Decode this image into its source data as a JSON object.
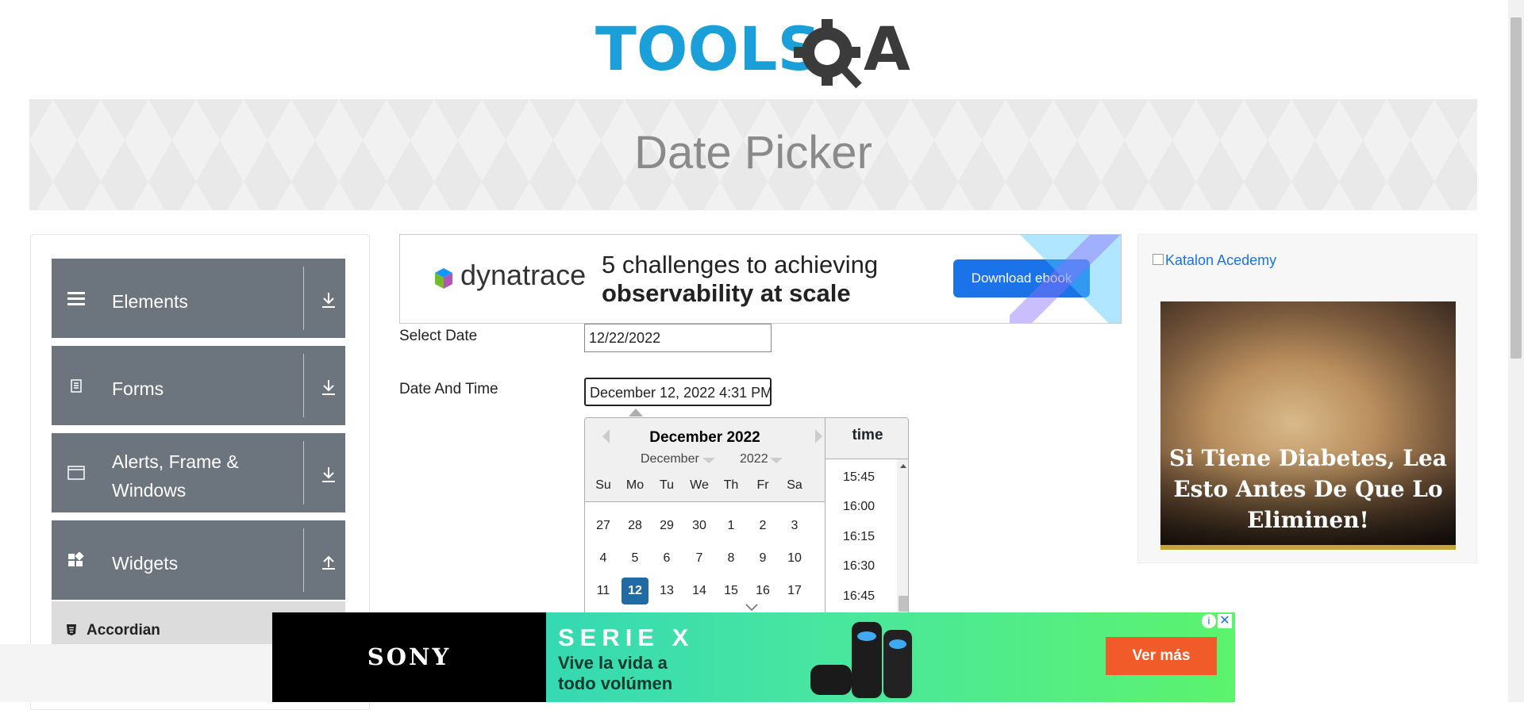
{
  "header": {
    "logo_text": "TOOLSQA",
    "page_title": "Date Picker"
  },
  "sidebar": {
    "groups": [
      {
        "label": "Elements",
        "icon": "hamburger-icon",
        "arrow": "download-icon"
      },
      {
        "label": "Forms",
        "icon": "document-icon",
        "arrow": "download-icon"
      },
      {
        "label": "Alerts, Frame &",
        "label2": "Windows",
        "icon": "window-icon",
        "arrow": "download-icon"
      },
      {
        "label": "Widgets",
        "icon": "widgets-icon",
        "arrow": "upload-icon"
      }
    ],
    "active_item": "Accordian"
  },
  "ad_top": {
    "brand": "dynatrace",
    "line1": "5 challenges to achieving",
    "line2": "observability at scale",
    "button": "Download ebook"
  },
  "form": {
    "select_date_label": "Select Date",
    "select_date_value": "12/22/2022",
    "date_time_label": "Date And Time",
    "date_time_value": "December 12, 2022 4:31 PM"
  },
  "picker": {
    "title": "December 2022",
    "month_select": "December",
    "year_select": "2022",
    "day_names": [
      "Su",
      "Mo",
      "Tu",
      "We",
      "Th",
      "Fr",
      "Sa"
    ],
    "weeks": [
      [
        "27",
        "28",
        "29",
        "30",
        "1",
        "2",
        "3"
      ],
      [
        "4",
        "5",
        "6",
        "7",
        "8",
        "9",
        "10"
      ],
      [
        "11",
        "12",
        "13",
        "14",
        "15",
        "16",
        "17"
      ]
    ],
    "selected_day": "12",
    "time_header": "time",
    "times": [
      "15:45",
      "16:00",
      "16:15",
      "16:30",
      "16:45"
    ]
  },
  "ad_right": {
    "link_text": "Katalon Acedemy",
    "caption": "Si Tiene Diabetes, Lea Esto Antes De Que Lo Eliminen!"
  },
  "ad_bottom": {
    "brand": "SONY",
    "line1": "SERIE X",
    "line2": "Vive la vida a todo volúmen",
    "button": "Ver más",
    "close": "✕",
    "info": "i"
  },
  "colors": {
    "accent": "#216ba5",
    "sidebar_group": "#6c757d",
    "logo_blue": "#1b9fd8"
  }
}
